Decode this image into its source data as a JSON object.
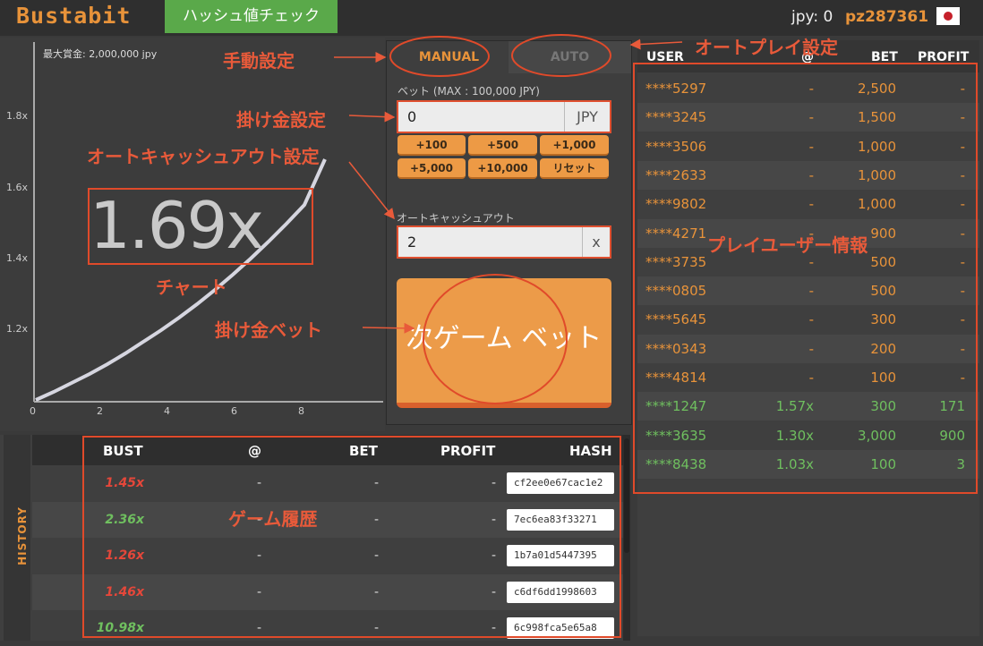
{
  "header": {
    "logo": "Bustabit",
    "hash_check": "ハッシュ値チェック",
    "balance": "jpy: 0",
    "username": "pz287361"
  },
  "chart": {
    "max_prize": "最大賞金: 2,000,000 jpy",
    "multiplier": "1.69x",
    "y_ticks": [
      "1.8x",
      "1.6x",
      "1.4x",
      "1.2x"
    ],
    "x_ticks": [
      "0",
      "2",
      "4",
      "6",
      "8"
    ]
  },
  "controls": {
    "tab_manual": "MANUAL",
    "tab_auto": "AUTO",
    "bet_label": "ベット (MAX : 100,000 JPY)",
    "bet_value": "0",
    "bet_unit": "JPY",
    "chips": [
      "+100",
      "+500",
      "+1,000",
      "+5,000",
      "+10,000",
      "リセット"
    ],
    "autocash_label": "オートキャッシュアウト",
    "autocash_value": "2",
    "autocash_unit": "x",
    "bet_button": "次ゲーム ベット"
  },
  "players": {
    "headers": [
      "USER",
      "@",
      "BET",
      "PROFIT"
    ],
    "rows": [
      {
        "user": "****5297",
        "at": "-",
        "bet": "2,500",
        "profit": "-",
        "status": "playing"
      },
      {
        "user": "****3245",
        "at": "-",
        "bet": "1,500",
        "profit": "-",
        "status": "playing"
      },
      {
        "user": "****3506",
        "at": "-",
        "bet": "1,000",
        "profit": "-",
        "status": "playing"
      },
      {
        "user": "****2633",
        "at": "-",
        "bet": "1,000",
        "profit": "-",
        "status": "playing"
      },
      {
        "user": "****9802",
        "at": "-",
        "bet": "1,000",
        "profit": "-",
        "status": "playing"
      },
      {
        "user": "****4271",
        "at": "-",
        "bet": "900",
        "profit": "-",
        "status": "playing"
      },
      {
        "user": "****3735",
        "at": "-",
        "bet": "500",
        "profit": "-",
        "status": "playing"
      },
      {
        "user": "****0805",
        "at": "-",
        "bet": "500",
        "profit": "-",
        "status": "playing"
      },
      {
        "user": "****5645",
        "at": "-",
        "bet": "300",
        "profit": "-",
        "status": "playing"
      },
      {
        "user": "****0343",
        "at": "-",
        "bet": "200",
        "profit": "-",
        "status": "playing"
      },
      {
        "user": "****4814",
        "at": "-",
        "bet": "100",
        "profit": "-",
        "status": "playing"
      },
      {
        "user": "****1247",
        "at": "1.57x",
        "bet": "300",
        "profit": "171",
        "status": "cashed"
      },
      {
        "user": "****3635",
        "at": "1.30x",
        "bet": "3,000",
        "profit": "900",
        "status": "cashed"
      },
      {
        "user": "****8438",
        "at": "1.03x",
        "bet": "100",
        "profit": "3",
        "status": "cashed"
      }
    ]
  },
  "history": {
    "side_label": "HISTORY",
    "headers": [
      "BUST",
      "@",
      "BET",
      "PROFIT",
      "HASH"
    ],
    "rows": [
      {
        "bust": "1.45x",
        "at": "-",
        "bet": "-",
        "profit": "-",
        "hash": "cf2ee0e67cac1e2",
        "result": "low"
      },
      {
        "bust": "2.36x",
        "at": "-",
        "bet": "-",
        "profit": "-",
        "hash": "7ec6ea83f33271",
        "result": "high"
      },
      {
        "bust": "1.26x",
        "at": "-",
        "bet": "-",
        "profit": "-",
        "hash": "1b7a01d5447395",
        "result": "low"
      },
      {
        "bust": "1.46x",
        "at": "-",
        "bet": "-",
        "profit": "-",
        "hash": "c6df6dd1998603",
        "result": "low"
      },
      {
        "bust": "10.98x",
        "at": "-",
        "bet": "-",
        "profit": "-",
        "hash": "6c998fca5e65a8",
        "result": "high"
      }
    ]
  },
  "annotations": {
    "manual": "手動設定",
    "auto": "オートプレイ設定",
    "bet_setting": "掛け金設定",
    "autocash_setting": "オートキャッシュアウト設定",
    "chart": "チャート",
    "bet_bet": "掛け金ベット",
    "player_info": "プレイユーザー情報",
    "history": "ゲーム履歴"
  },
  "colors": {
    "accent": "#e8933a",
    "cashed_green": "#6fbf5f",
    "bust_red": "#e5473a",
    "annotation_red": "#e85a3a"
  }
}
